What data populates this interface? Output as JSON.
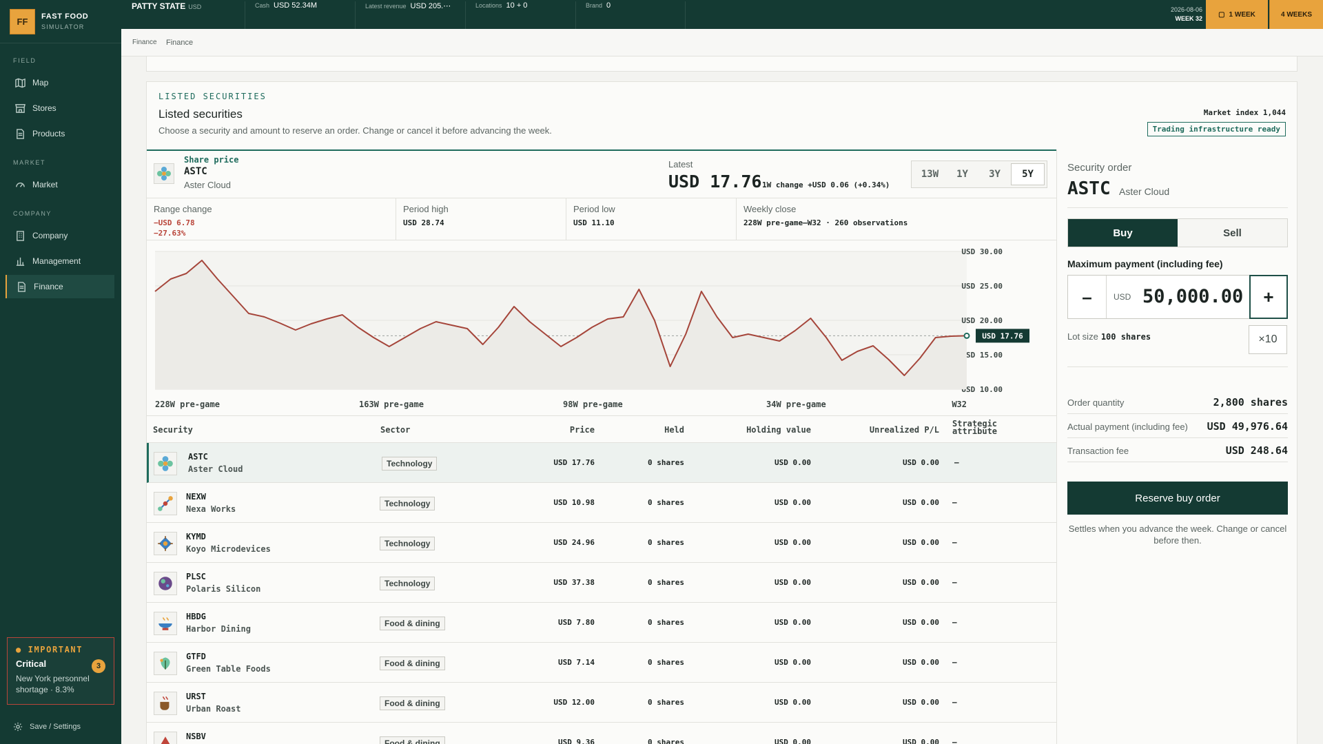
{
  "app": {
    "logo": "FF",
    "title": "FAST FOOD",
    "subtitle": "SIMULATOR"
  },
  "sidebar": {
    "sections": [
      "FIELD",
      "MARKET",
      "COMPANY"
    ],
    "items": [
      {
        "label": "Map",
        "icon": "map-icon"
      },
      {
        "label": "Stores",
        "icon": "store-icon"
      },
      {
        "label": "Products",
        "icon": "document-icon"
      },
      {
        "label": "Market",
        "icon": "gauge-icon"
      },
      {
        "label": "Company",
        "icon": "building-icon"
      },
      {
        "label": "Management",
        "icon": "bar-chart-icon"
      },
      {
        "label": "Finance",
        "icon": "document-icon",
        "active": true
      }
    ],
    "alert": {
      "heading": "IMPORTANT",
      "title": "Critical",
      "count": "3",
      "text": "New York personnel shortage · 8.3%"
    },
    "settings_label": "Save / Settings"
  },
  "topbar": {
    "company": "PATTY STATE",
    "currency": "USD",
    "stats": [
      {
        "label": "Cash",
        "value": "USD 52.34M"
      },
      {
        "label": "Latest revenue",
        "value": "USD 205.⋯"
      },
      {
        "label": "Locations",
        "value": "10 + 0"
      },
      {
        "label": "Brand",
        "value": "0"
      }
    ],
    "date": "2026-08-06",
    "week": "WEEK 32",
    "advance_1": "1 WEEK",
    "advance_4": "4 WEEKS"
  },
  "breadcrumb": [
    "Finance",
    "Finance"
  ],
  "panel": {
    "kicker": "LISTED SECURITIES",
    "title": "Listed securities",
    "subtitle": "Choose a security and amount to reserve an order. Change or cancel it before advancing the week.",
    "market_index": "Market index 1,044",
    "status": "Trading infrastructure ready"
  },
  "chart_header": {
    "label": "Share price",
    "ticker": "ASTC",
    "name": "Aster Cloud",
    "latest_label": "Latest",
    "latest_value": "USD 17.76",
    "change": "1W change +USD 0.06 (+0.34%)",
    "ranges": [
      "13W",
      "1Y",
      "3Y",
      "5Y"
    ],
    "active_range": "5Y"
  },
  "stats": [
    {
      "label": "Range change",
      "value": "−USD 6.78",
      "value2": "−27.63%"
    },
    {
      "label": "Period high",
      "value": "USD 28.74"
    },
    {
      "label": "Period low",
      "value": "USD 11.10"
    },
    {
      "label": "Weekly close",
      "value": "228W pre-game–W32 · 260 observations"
    }
  ],
  "chart_data": {
    "type": "line",
    "x_labels": [
      "228W pre-game",
      "163W pre-game",
      "98W pre-game",
      "34W pre-game",
      "W32"
    ],
    "y_ticks": [
      "USD 30.00",
      "USD 25.00",
      "USD 20.00",
      "USD 15.00",
      "USD 10.00"
    ],
    "ylim": [
      10,
      30
    ],
    "current_label": "USD 17.76",
    "series": [
      {
        "values": [
          24.2,
          26.0,
          26.8,
          28.7,
          26.0,
          23.5,
          21.0,
          20.5,
          19.6,
          18.6,
          19.5,
          20.2,
          20.8,
          19.0,
          17.5,
          16.2,
          17.5,
          18.8,
          19.8,
          19.3,
          18.8,
          16.5,
          19.0,
          22.0,
          19.8,
          18.0,
          16.2,
          17.5,
          19.0,
          20.2,
          20.5,
          24.5,
          20.0,
          13.3,
          18.0,
          24.2,
          20.5,
          17.5,
          18.0,
          17.5,
          17.0,
          18.5,
          20.3,
          17.5,
          14.2,
          15.5,
          16.3,
          14.3,
          12.0,
          14.5,
          17.5,
          17.7,
          17.76
        ]
      }
    ]
  },
  "table": {
    "headers": [
      "Security",
      "Sector",
      "Price",
      "Held",
      "Holding value",
      "Unrealized P/L",
      "Strategic attribute"
    ],
    "rows": [
      {
        "ticker": "ASTC",
        "name": "Aster Cloud",
        "sector": "Technology",
        "price": "USD 17.76",
        "held": "0 shares",
        "value": "USD 0.00",
        "pl": "USD 0.00",
        "attr": "—",
        "icon": "flower-icon"
      },
      {
        "ticker": "NEXW",
        "name": "Nexa Works",
        "sector": "Technology",
        "price": "USD 10.98",
        "held": "0 shares",
        "value": "USD 0.00",
        "pl": "USD 0.00",
        "attr": "—",
        "icon": "network-icon"
      },
      {
        "ticker": "KYMD",
        "name": "Koyo Microdevices",
        "sector": "Technology",
        "price": "USD 24.96",
        "held": "0 shares",
        "value": "USD 0.00",
        "pl": "USD 0.00",
        "attr": "—",
        "icon": "chip-icon"
      },
      {
        "ticker": "PLSC",
        "name": "Polaris Silicon",
        "sector": "Technology",
        "price": "USD 37.38",
        "held": "0 shares",
        "value": "USD 0.00",
        "pl": "USD 0.00",
        "attr": "—",
        "icon": "planet-icon"
      },
      {
        "ticker": "HBDG",
        "name": "Harbor Dining",
        "sector": "Food & dining",
        "price": "USD 7.80",
        "held": "0 shares",
        "value": "USD 0.00",
        "pl": "USD 0.00",
        "attr": "—",
        "icon": "bowl-icon"
      },
      {
        "ticker": "GTFD",
        "name": "Green Table Foods",
        "sector": "Food & dining",
        "price": "USD 7.14",
        "held": "0 shares",
        "value": "USD 0.00",
        "pl": "USD 0.00",
        "attr": "—",
        "icon": "leaf-icon"
      },
      {
        "ticker": "URST",
        "name": "Urban Roast",
        "sector": "Food & dining",
        "price": "USD 12.00",
        "held": "0 shares",
        "value": "USD 0.00",
        "pl": "USD 0.00",
        "attr": "—",
        "icon": "coffee-icon"
      },
      {
        "ticker": "NSBV",
        "name": "",
        "sector": "Food & dining",
        "price": "USD 9.36",
        "held": "0 shares",
        "value": "USD 0.00",
        "pl": "USD 0.00",
        "attr": "—",
        "icon": "drop-icon"
      }
    ]
  },
  "order": {
    "label": "Security order",
    "ticker": "ASTC",
    "name": "Aster Cloud",
    "buy": "Buy",
    "sell": "Sell",
    "payment_label": "Maximum payment (including fee)",
    "currency": "USD",
    "amount": "50,000.00",
    "lot_label": "Lot size",
    "lot_value": "100 shares",
    "multiplier": "×10",
    "rows": [
      {
        "label": "Order quantity",
        "value": "2,800 shares"
      },
      {
        "label": "Actual payment (including fee)",
        "value": "USD 49,976.64"
      },
      {
        "label": "Transaction fee",
        "value": "USD 248.64"
      }
    ],
    "reserve": "Reserve buy order",
    "note": "Settles when you advance the week. Change or cancel before then."
  },
  "colors": {
    "primary": "#143a33",
    "accent": "#e8a33d",
    "line": "#a5453a",
    "teal": "#1e6b5c"
  }
}
